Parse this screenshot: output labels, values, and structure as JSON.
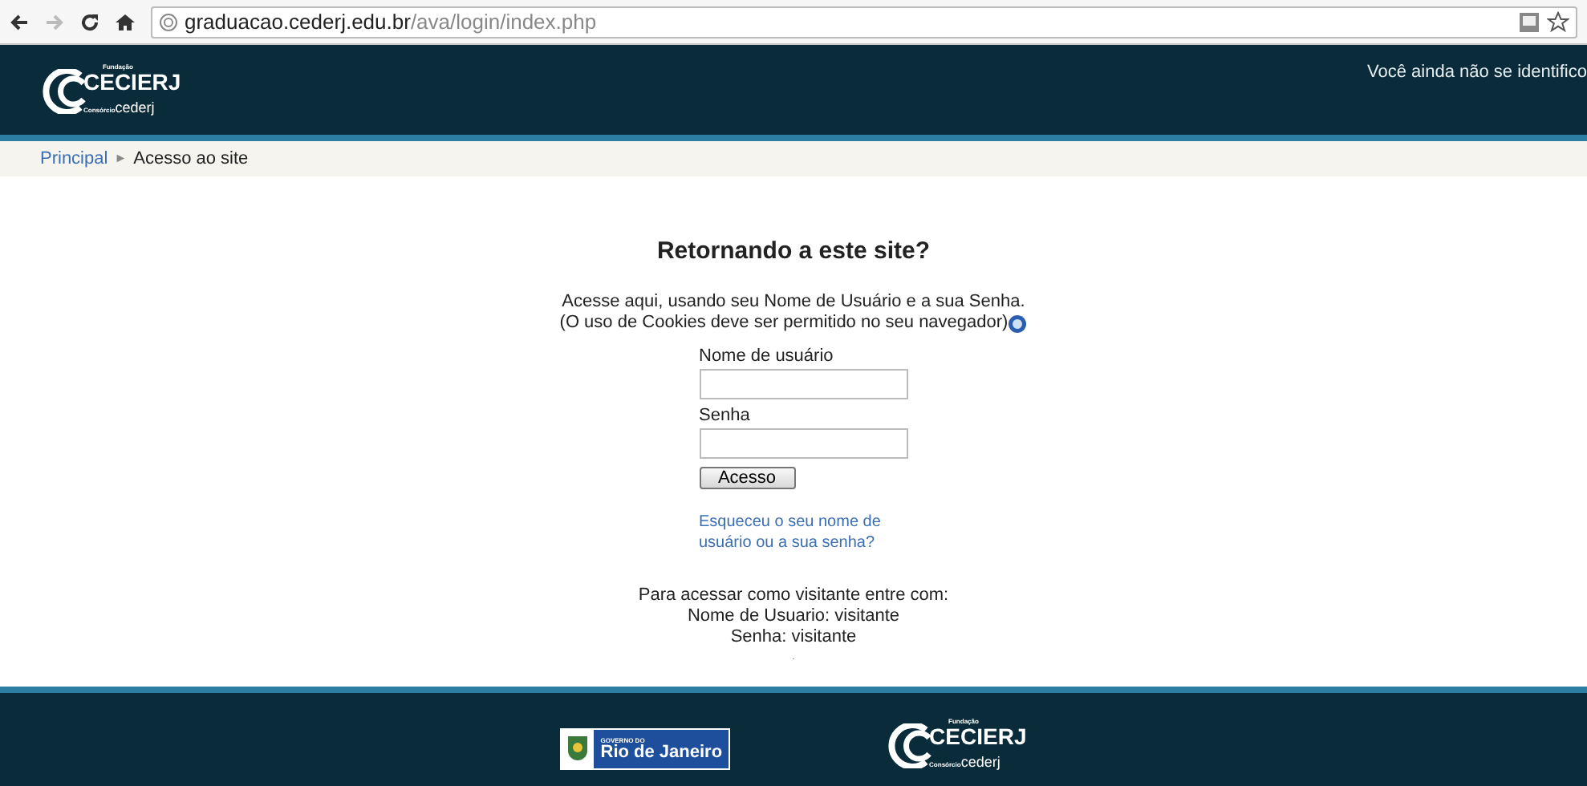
{
  "browser": {
    "url_host": "graduacao.cederj.edu.br",
    "url_path": "/ava/login/index.php"
  },
  "header": {
    "logo": {
      "top": "Fundação",
      "main": "CECIERJ",
      "sub_small": "Consórcio",
      "sub": "cederj"
    },
    "login_status": "Você ainda não se identifico"
  },
  "breadcrumb": [
    {
      "label": "Principal",
      "link": true
    },
    {
      "label": "Acesso ao site",
      "link": false
    }
  ],
  "breadcrumb_separator": "►",
  "login": {
    "title": "Retornando a este site?",
    "intro": "Acesse aqui, usando seu Nome de Usuário e a sua Senha.",
    "cookies_note": "(O uso de Cookies deve ser permitido no seu navegador)",
    "fields": [
      {
        "label": "Nome de usuário"
      },
      {
        "label": "Senha"
      }
    ],
    "submit": "Acesso",
    "forgot": [
      "Esqueceu o seu nome de",
      "usuário ou a sua senha?"
    ],
    "guest": [
      "Para acessar como visitante entre com:",
      "Nome de Usuario: visitante",
      "Senha: visitante"
    ],
    "note": "."
  },
  "footer": {
    "gov_logo": {
      "small": "GOVERNO DO",
      "main": "Rio de Janeiro"
    },
    "logo": {
      "top": "Fundação",
      "main": "CECIERJ",
      "sub_small": "Consórcio",
      "sub": "cederj"
    }
  }
}
